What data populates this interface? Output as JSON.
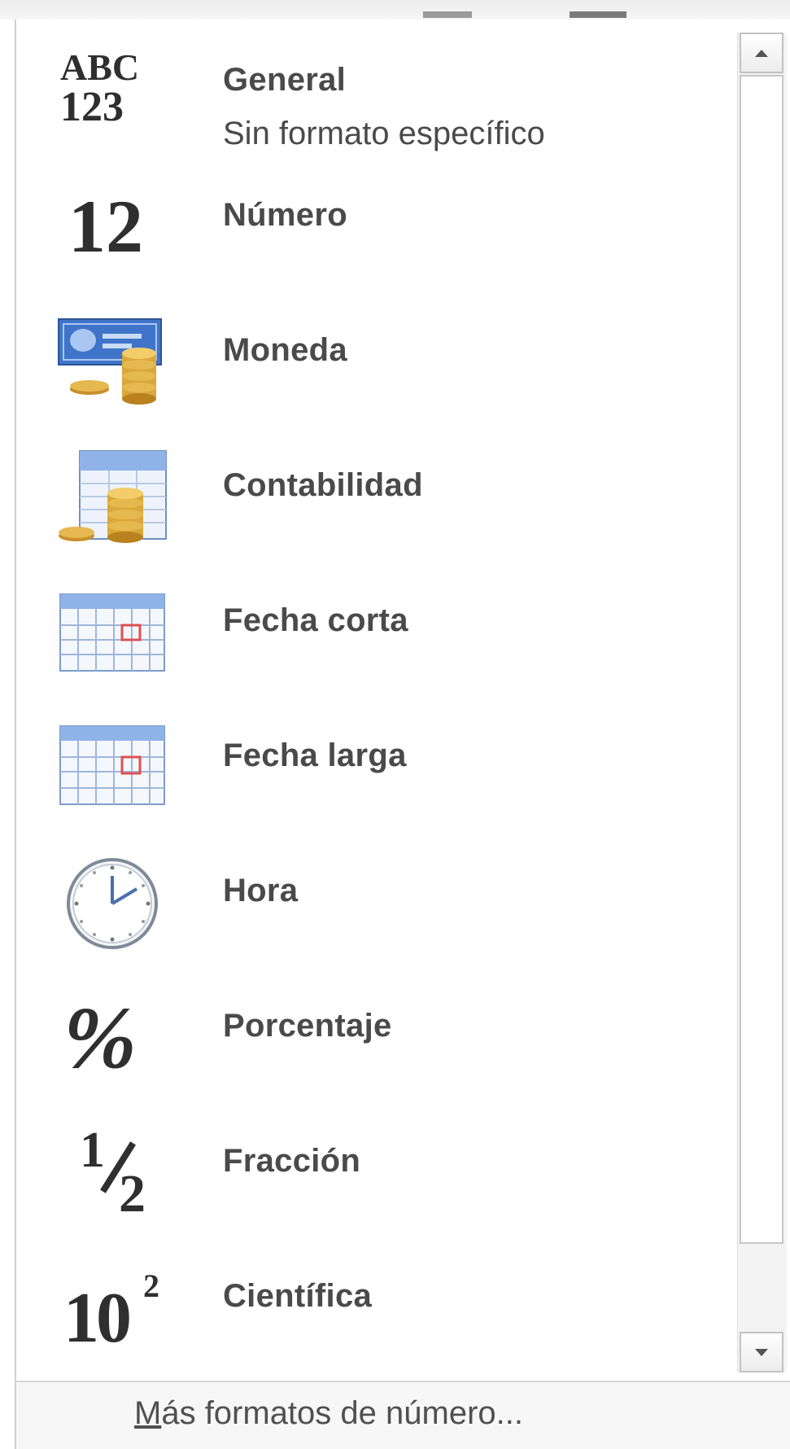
{
  "formats": [
    {
      "key": "general",
      "label": "General",
      "sub": "Sin formato específico",
      "icon": "abc-123-icon",
      "glyph_top": "ABC",
      "glyph_bottom": "123"
    },
    {
      "key": "number",
      "label": "Número",
      "icon": "number-12-icon",
      "glyph": "12"
    },
    {
      "key": "currency",
      "label": "Moneda",
      "icon": "currency-bill-coins-icon"
    },
    {
      "key": "accounting",
      "label": "Contabilidad",
      "icon": "accounting-ledger-coins-icon"
    },
    {
      "key": "short-date",
      "label": "Fecha corta",
      "icon": "calendar-icon"
    },
    {
      "key": "long-date",
      "label": "Fecha larga",
      "icon": "calendar-icon"
    },
    {
      "key": "time",
      "label": "Hora",
      "icon": "clock-icon"
    },
    {
      "key": "percentage",
      "label": "Porcentaje",
      "icon": "percent-icon",
      "glyph": "%"
    },
    {
      "key": "fraction",
      "label": "Fracción",
      "icon": "fraction-half-icon",
      "glyph_num": "1",
      "glyph_den": "2"
    },
    {
      "key": "scientific",
      "label": "Científica",
      "icon": "scientific-power-icon",
      "glyph_base": "10",
      "glyph_exp": "2"
    }
  ],
  "footer": {
    "more_link_first": "M",
    "more_link_rest": "ás formatos de número..."
  },
  "colors": {
    "label_text": "#4a4a4a",
    "calendar_header": "#8fb3e8",
    "calendar_marker": "#e05050",
    "coin_gold": "#d9a83a"
  }
}
